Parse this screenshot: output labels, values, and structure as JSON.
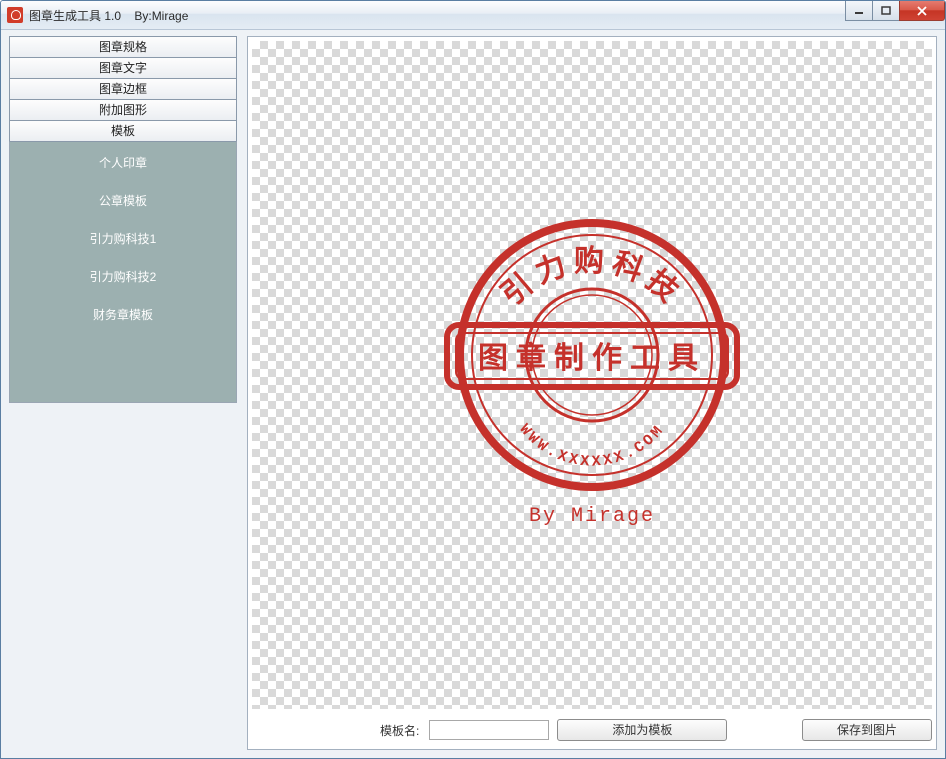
{
  "window": {
    "title": "图章生成工具 1.0    By:Mirage"
  },
  "sidebar": {
    "sections": [
      {
        "label": "图章规格"
      },
      {
        "label": "图章文字"
      },
      {
        "label": "图章边框"
      },
      {
        "label": "附加图形"
      },
      {
        "label": "模板"
      }
    ],
    "template_items": [
      {
        "label": "个人印章"
      },
      {
        "label": "公章模板"
      },
      {
        "label": "引力购科技1"
      },
      {
        "label": "引力购科技2"
      },
      {
        "label": "财务章模板"
      }
    ]
  },
  "stamp": {
    "top_arc_text": "引力购科技",
    "bottom_arc_text": "WWW.XXXXXX.COM",
    "banner_text": "图章制作工具",
    "byline": "By Mirage",
    "color": "#c5312b"
  },
  "bottom": {
    "template_name_label": "模板名:",
    "template_name_value": "",
    "add_template_button": "添加为模板",
    "save_image_button": "保存到图片"
  }
}
